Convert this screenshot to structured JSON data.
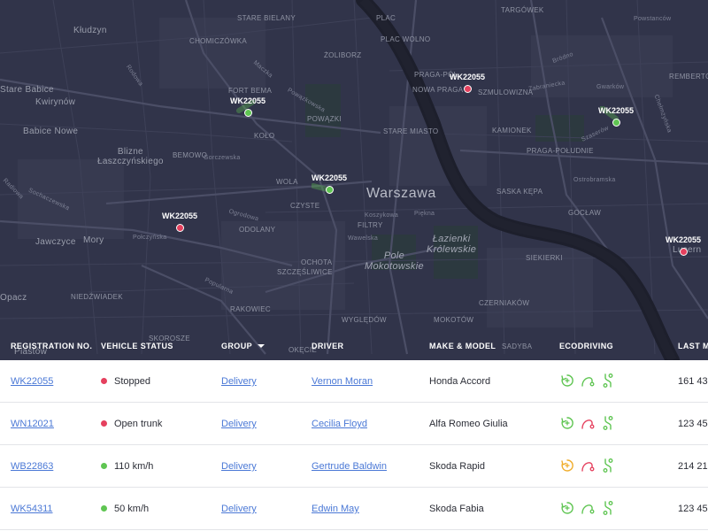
{
  "colors": {
    "map_bg": "#31344a",
    "river": "#1d1f2c",
    "accent_link": "#4a78d6",
    "status_red": "#e5405e",
    "status_green": "#5fc552",
    "eco_green": "#5fc552",
    "eco_red": "#e5405e",
    "eco_amber": "#f0ad2c"
  },
  "map": {
    "labels": [
      "STARE BIELANY",
      "CHOMICZÓWKA",
      "ŻOLIBORZ",
      "PLAC",
      "PLAC WOLNO",
      "TARGÓWEK",
      "Powstanców",
      "Kłudzyn",
      "Stare Babice",
      "Kwirynów",
      "Babice Nowe",
      "Blizne\nŁaszczyńskiego",
      "FORT BEMA",
      "KOŁO",
      "POWĄZKI",
      "PRAGA-PÓŁ",
      "NOWA PRAGA",
      "SZMULOWIZNA",
      "KAMIONEK",
      "STARE MIASTO",
      "PRAGA-POŁUDNIE",
      "BEMOWO",
      "WOLA",
      "CZYSTE",
      "Warszawa",
      "SASKA KĘPA",
      "GOCŁAW",
      "ODOLANY",
      "FILTRY",
      "Łazienki\nKrólewskie",
      "Pole\nMokotowskie",
      "SIEKIERKI",
      "Jawczyce",
      "Mory",
      "OCHOTA",
      "SZCZĘŚLIWICE",
      "Opacz",
      "NIEDŹWIADEK",
      "RAKOWIEC",
      "WYGLĘDÓW",
      "CZERNIAKÓW",
      "MOKOTÓW",
      "SKOROSZE",
      "Piastów",
      "OKĘCIE",
      "SADYBA",
      "REMBERTÓW",
      "Lucern",
      "Bródno",
      "Gwarków",
      "Ostrobramska",
      "Szaserów",
      "Koszykowa",
      "Piękna",
      "Wawelska",
      "Połczyńska",
      "Popularna",
      "Gorczewska",
      "Sochaczewska",
      "Rodowa",
      "Maczka",
      "Powązkowska",
      "Radiowa",
      "Ogrodowa",
      "Zabraniecka",
      "Chełmżyńska"
    ],
    "markers": [
      {
        "label": "WK22055",
        "status": "green"
      },
      {
        "label": "WK22055",
        "status": "red"
      },
      {
        "label": "WK22055",
        "status": "green"
      },
      {
        "label": "WK22055",
        "status": "green"
      },
      {
        "label": "WK22055",
        "status": "red"
      },
      {
        "label": "WK22055",
        "status": "red"
      }
    ]
  },
  "table": {
    "headers": {
      "registration": "REGISTRATION NO.",
      "vehicle_status": "VEHICLE STATUS",
      "group": "GROUP",
      "driver": "DRIVER",
      "make_model": "MAKE & MODEL",
      "ecodriving": "ECODRIVING",
      "last": "LAST M"
    },
    "rows": [
      {
        "registration": "WK22055",
        "status_color": "#e5405e",
        "status": "Stopped",
        "group": "Delivery",
        "driver": "Vernon Moran",
        "make_model": "Honda Accord",
        "eco": [
          "green",
          "green",
          "green"
        ],
        "last": "161 43"
      },
      {
        "registration": "WN12021",
        "status_color": "#e5405e",
        "status": "Open trunk",
        "group": "Delivery",
        "driver": "Cecilia Floyd",
        "make_model": "Alfa Romeo Giulia",
        "eco": [
          "green",
          "red",
          "green"
        ],
        "last": "123 45"
      },
      {
        "registration": "WB22863",
        "status_color": "#5fc552",
        "status": "110 km/h",
        "group": "Delivery",
        "driver": "Gertrude Baldwin",
        "make_model": "Skoda Rapid",
        "eco": [
          "amber",
          "red",
          "green"
        ],
        "last": "214 21"
      },
      {
        "registration": "WK54311",
        "status_color": "#5fc552",
        "status": "50 km/h",
        "group": "Delivery",
        "driver": "Edwin May",
        "make_model": "Skoda Fabia",
        "eco": [
          "green",
          "green",
          "green"
        ],
        "last": "123 45"
      }
    ]
  }
}
